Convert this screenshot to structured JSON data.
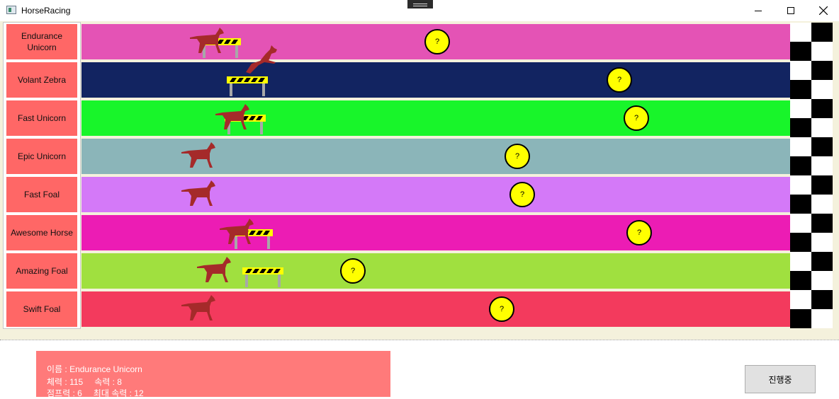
{
  "window": {
    "title": "HorseRacing"
  },
  "lanes": [
    {
      "name": "Endurance Unicorn",
      "color": "#e453b5"
    },
    {
      "name": "Volant Zebra",
      "color": "#122461"
    },
    {
      "name": "Fast Unicorn",
      "color": "#18f52a"
    },
    {
      "name": "Epic Unicorn",
      "color": "#8bb5b9"
    },
    {
      "name": "Fast Foal",
      "color": "#d479f8"
    },
    {
      "name": "Awesome Horse",
      "color": "#ec1cb4"
    },
    {
      "name": "Amazing Foal",
      "color": "#a0e03f"
    },
    {
      "name": "Swift Foal",
      "color": "#f33a5d"
    }
  ],
  "mystery_label": "?",
  "info": {
    "name_label": "이름 : Endurance Unicorn",
    "stamina_label": "체력 : 115",
    "speed_label": "속력 : 8",
    "jump_label": "점프력 : 6",
    "max_speed_label": "최대 속력 : 12"
  },
  "status_button": {
    "label": "진행중"
  },
  "colors": {
    "name_button": "#ff6766",
    "horse": "#a52a2a",
    "coin": "#ffff00",
    "info_panel": "#ff7a7a",
    "track_bg": "#f4f1dc"
  }
}
